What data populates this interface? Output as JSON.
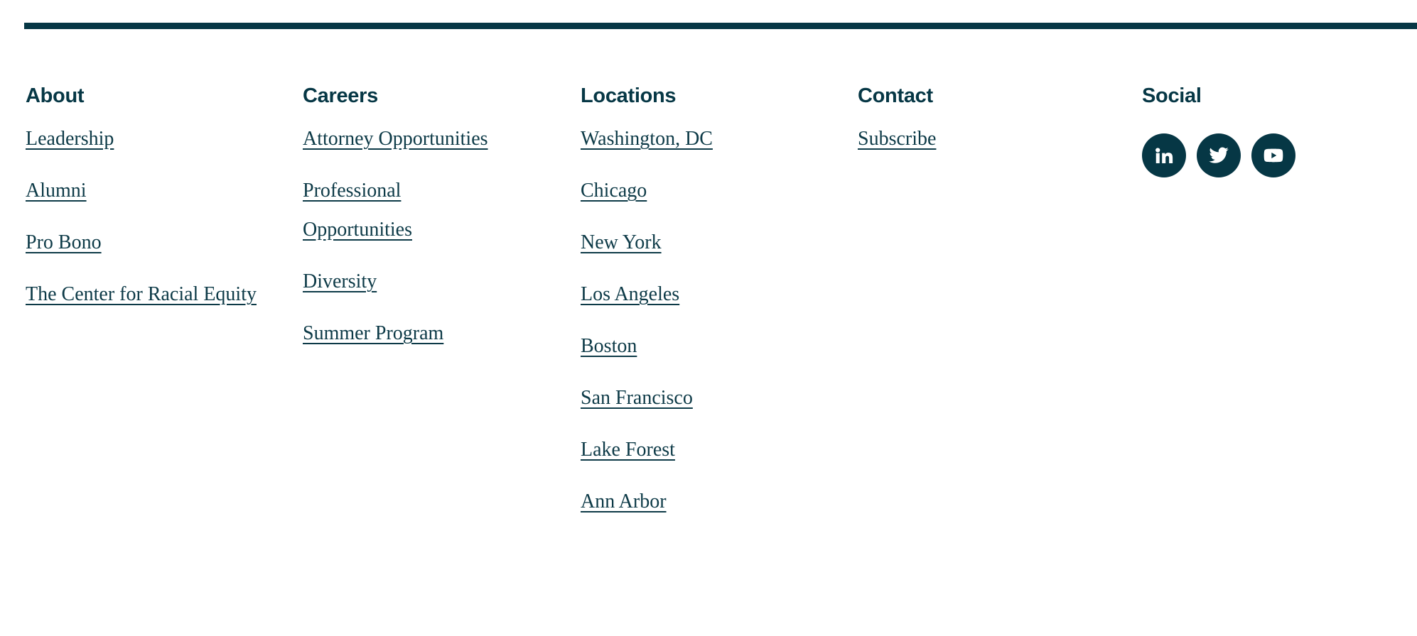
{
  "theme": {
    "accent": "#063745",
    "link_color": "#0d3a47",
    "background": "#ffffff"
  },
  "divider": {
    "name": "top-divider-rule"
  },
  "footer": {
    "columns": [
      {
        "heading": "About",
        "links": [
          "Leadership",
          "Alumni",
          "Pro Bono",
          "The Center for Racial Equity"
        ]
      },
      {
        "heading": "Careers",
        "links": [
          "Attorney Opportunities",
          "Professional Opportunities",
          "Diversity",
          "Summer Program"
        ]
      },
      {
        "heading": "Locations",
        "links": [
          "Washington, DC",
          "Chicago",
          "New York",
          "Los Angeles",
          "Boston",
          "San Francisco",
          "Lake Forest",
          "Ann Arbor"
        ]
      },
      {
        "heading": "Contact",
        "links": [
          "Subscribe"
        ]
      },
      {
        "heading": "Social",
        "links": [],
        "social": [
          {
            "icon": "linkedin-icon",
            "label": "LinkedIn"
          },
          {
            "icon": "twitter-icon",
            "label": "Twitter"
          },
          {
            "icon": "youtube-icon",
            "label": "YouTube"
          }
        ]
      }
    ]
  }
}
